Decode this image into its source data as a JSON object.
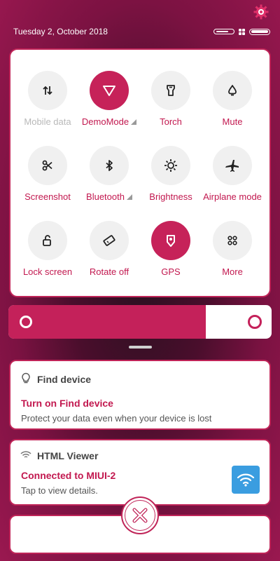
{
  "status_bar": {
    "date": "Tuesday 2, October 2018",
    "icons": [
      "toggle-pill-icon",
      "grid-icon",
      "battery-icon"
    ]
  },
  "quick_settings": {
    "tiles": [
      {
        "label": "Mobile data",
        "icon": "mobile-data-icon",
        "active": false,
        "dim": true
      },
      {
        "label": "DemoMode",
        "icon": "signal-triangle-icon",
        "active": true,
        "dim": false
      },
      {
        "label": "Torch",
        "icon": "torch-icon",
        "active": false,
        "dim": false
      },
      {
        "label": "Mute",
        "icon": "bell-icon",
        "active": false,
        "dim": false
      },
      {
        "label": "Screenshot",
        "icon": "scissors-icon",
        "active": false,
        "dim": false
      },
      {
        "label": "Bluetooth",
        "icon": "bluetooth-icon",
        "active": false,
        "dim": false
      },
      {
        "label": "Brightness",
        "icon": "sun-icon",
        "active": false,
        "dim": false
      },
      {
        "label": "Airplane mode",
        "icon": "airplane-icon",
        "active": false,
        "dim": false
      },
      {
        "label": "Lock screen",
        "icon": "lock-icon",
        "active": false,
        "dim": false
      },
      {
        "label": "Rotate off",
        "icon": "rotate-icon",
        "active": false,
        "dim": false
      },
      {
        "label": "GPS",
        "icon": "location-pin-icon",
        "active": true,
        "dim": false
      },
      {
        "label": "More",
        "icon": "more-dots-icon",
        "active": false,
        "dim": false
      }
    ],
    "accent_color": "#c62259"
  },
  "brightness_slider": {
    "level_percent": 75
  },
  "notifications": [
    {
      "app": "Find device",
      "title": "Turn on Find device",
      "body": "Protect your data even when your device is lost"
    },
    {
      "app": "HTML Viewer",
      "title": "Connected to MIUI-2",
      "body": "Tap to view details."
    }
  ]
}
